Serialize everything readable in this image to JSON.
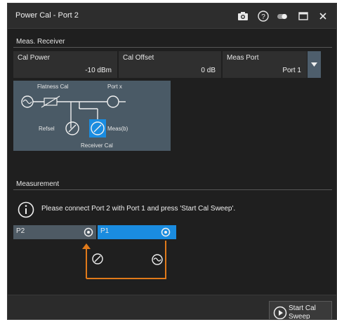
{
  "window": {
    "title": "Power Cal - Port 2"
  },
  "titlebar_icons": [
    "camera-icon",
    "help-icon",
    "toggle-icon",
    "maximize-icon",
    "close-icon"
  ],
  "meas_receiver": {
    "header": "Meas. Receiver",
    "cal_power": {
      "label": "Cal Power",
      "value": "-10 dBm"
    },
    "cal_offset": {
      "label": "Cal Offset",
      "value": "0 dB"
    },
    "meas_port": {
      "label": "Meas Port",
      "value": "Port 1"
    }
  },
  "diagram": {
    "flatness_cal": "Flatness Cal",
    "port_x": "Port x",
    "refsel": "Refsel",
    "meas_sel": "Meas(b)",
    "receiver_cal": "Receiver Cal"
  },
  "measurement": {
    "header": "Measurement",
    "instruction": "Please connect Port 2 with Port 1 and press 'Start Cal Sweep'.",
    "port_left": "P2",
    "port_right": "P1"
  },
  "footer": {
    "start_button": "Start Cal Sweep",
    "start_line1": "Start Cal",
    "start_line2": "Sweep"
  },
  "colors": {
    "accent": "#1a8ce0",
    "wire": "#e07a1a",
    "window_bg": "#1f1f1f",
    "field_bg": "#2f2f2f"
  }
}
